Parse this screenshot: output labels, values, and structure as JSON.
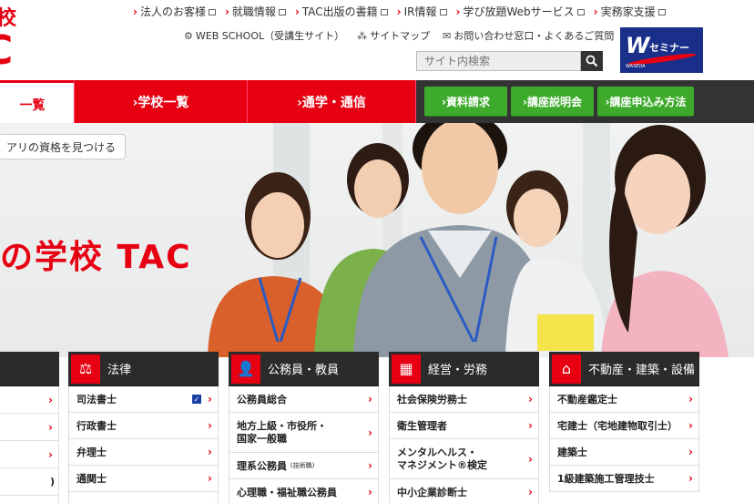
{
  "logo": {
    "line1": "校",
    "line2": "C"
  },
  "top_links": [
    {
      "label": "法人のお客様"
    },
    {
      "label": "就職情報"
    },
    {
      "label": "TAC出版の書籍"
    },
    {
      "label": "IR情報"
    },
    {
      "label": "学び放題Webサービス"
    },
    {
      "label": "実務家支援"
    }
  ],
  "sub_links": [
    {
      "icon": "gear-icon",
      "label": "WEB SCHOOL（受講生サイト）"
    },
    {
      "icon": "sitemap-icon",
      "label": "サイトマップ"
    },
    {
      "icon": "mail-icon",
      "label": "お問い合わせ窓口・よくあるご質問"
    }
  ],
  "search": {
    "placeholder": "サイト内検索"
  },
  "seminar": {
    "mark": "W",
    "label": "セミナー",
    "sub": "WASEDA"
  },
  "nav": {
    "tabs": [
      "一覧",
      "›学校一覧",
      "›通学・通信"
    ],
    "green_buttons": [
      "›資料請求",
      "›講座説明会",
      "›講座申込み方法"
    ]
  },
  "hero": {
    "pill": "アリの資格を見つける",
    "catch": "の学校 TAC"
  },
  "categories": [
    {
      "title": "",
      "icon": "",
      "items": [
        "",
        "",
        "",
        ")",
        ""
      ]
    },
    {
      "title": "法律",
      "icon": "scales-icon",
      "items": [
        "司法書士",
        "行政書士",
        "弁理士",
        "通関士",
        ""
      ]
    },
    {
      "title": "公務員・教員",
      "icon": "person-icon",
      "items": [
        "公務員総合",
        "地方上級・市役所・\n国家一般職",
        "理系公務員",
        "心理職・福祉職公務員"
      ],
      "item3_note": "(技術職)"
    },
    {
      "title": "経営・労務",
      "icon": "calculator-icon",
      "items": [
        "社会保険労務士",
        "衛生管理者",
        "メンタルヘルス・\nマネジメント®検定",
        "中小企業診断士"
      ]
    },
    {
      "title": "不動産・建築・設備",
      "icon": "house-icon",
      "items": [
        "不動産鑑定士",
        "宅建士（宅地建物取引士）",
        "建築士",
        "1級建築施工管理技士"
      ]
    }
  ]
}
